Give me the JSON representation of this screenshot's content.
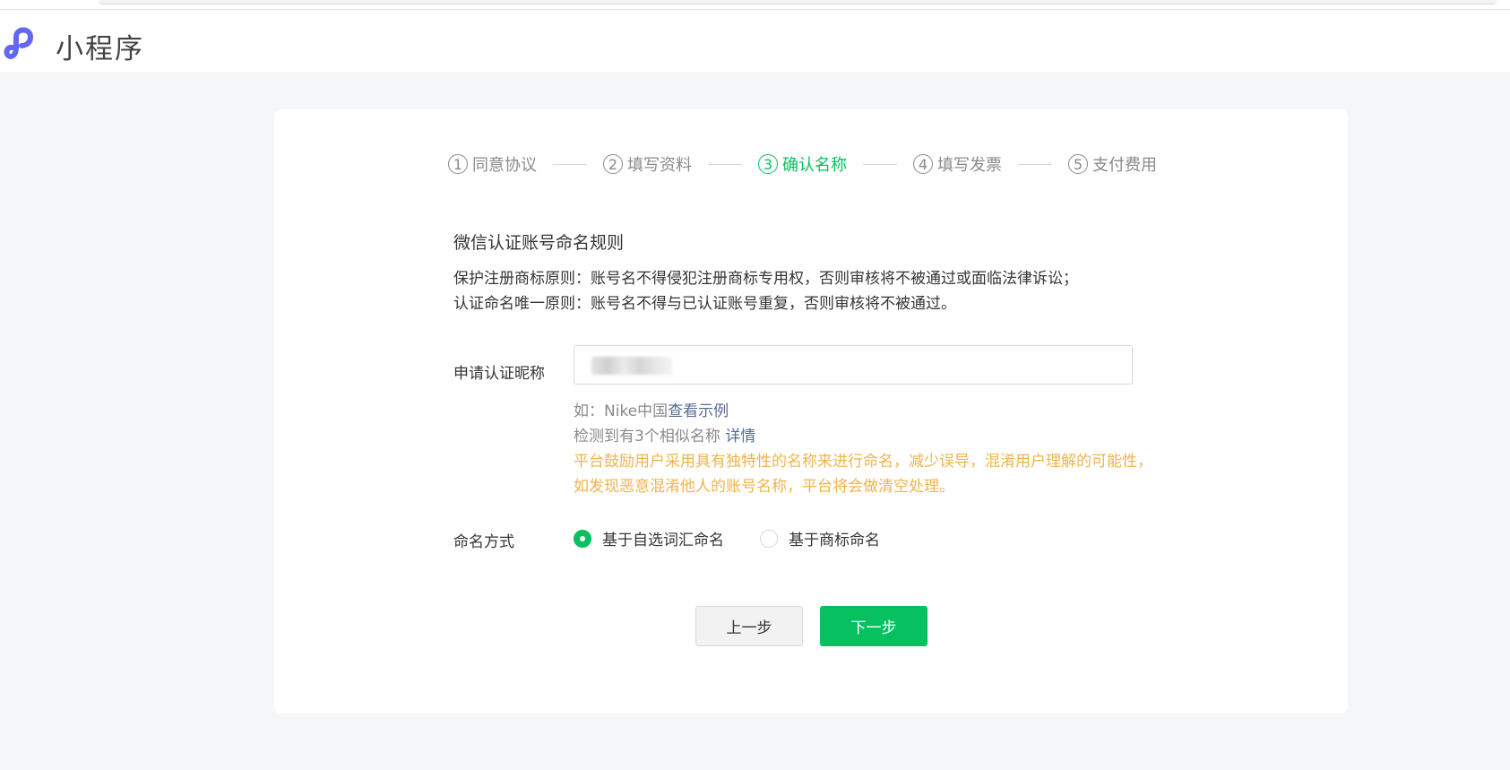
{
  "header": {
    "app_title": "小程序",
    "logo_icon": "mini-program-logo-icon",
    "brand_color": "#6467f0"
  },
  "steps": [
    {
      "number": "1",
      "label": "同意协议",
      "state": "done"
    },
    {
      "number": "2",
      "label": "填写资料",
      "state": "done"
    },
    {
      "number": "3",
      "label": "确认名称",
      "state": "active"
    },
    {
      "number": "4",
      "label": "填写发票",
      "state": "pending"
    },
    {
      "number": "5",
      "label": "支付费用",
      "state": "pending"
    }
  ],
  "rules": {
    "title": "微信认证账号命名规则",
    "line1": "保护注册商标原则：账号名不得侵犯注册商标专用权，否则审核将不被通过或面临法律诉讼；",
    "line2": "认证命名唯一原则：账号名不得与已认证账号重复，否则审核将不被通过。"
  },
  "name_field": {
    "label": "申请认证昵称",
    "value": "",
    "example_prefix": "如：Nike中国",
    "example_link": "查看示例",
    "similar_text": "检测到有3个相似名称 ",
    "similar_link": "详情",
    "warning1": "平台鼓励用户采用具有独特性的名称来进行命名，减少误导，混淆用户理解的可能性，",
    "warning2": "如发现恶意混淆他人的账号名称，平台将会做清空处理。"
  },
  "naming_mode": {
    "label": "命名方式",
    "options": [
      {
        "label": "基于自选词汇命名",
        "checked": true
      },
      {
        "label": "基于商标命名",
        "checked": false
      }
    ]
  },
  "buttons": {
    "prev": "上一步",
    "next": "下一步"
  },
  "colors": {
    "accent": "#07c160",
    "warning": "#f0b44c",
    "link": "#576b95"
  }
}
